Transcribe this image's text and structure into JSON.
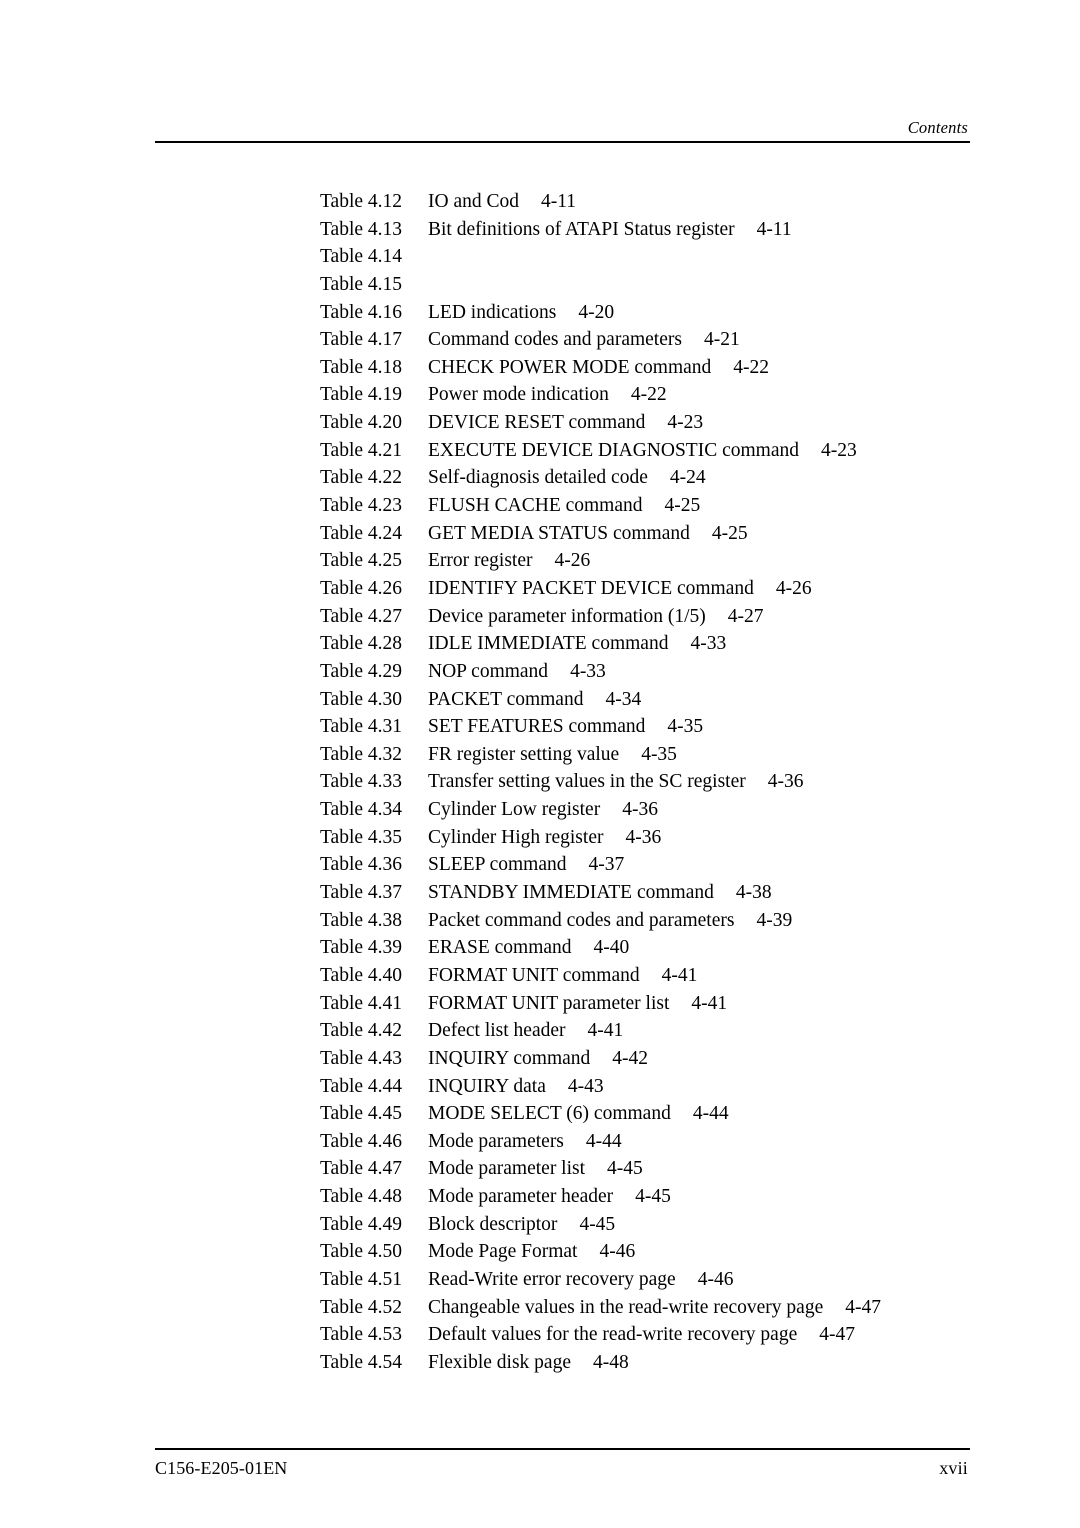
{
  "header": {
    "title": "Contents"
  },
  "footer": {
    "document_code": "C156-E205-01EN",
    "page_number": "xvii"
  },
  "toc": {
    "entries": [
      {
        "label": "Table 4.12",
        "title": "IO and Cod",
        "page": "4-11"
      },
      {
        "label": "Table 4.13",
        "title": "Bit definitions of ATAPI Status register",
        "page": "4-11"
      },
      {
        "label": "Table 4.14",
        "title": "",
        "page": ""
      },
      {
        "label": "Table 4.15",
        "title": "",
        "page": ""
      },
      {
        "label": "Table 4.16",
        "title": "LED indications",
        "page": "4-20"
      },
      {
        "label": "Table 4.17",
        "title": "Command codes and parameters",
        "page": "4-21"
      },
      {
        "label": "Table 4.18",
        "title": "CHECK POWER MODE command",
        "page": "4-22"
      },
      {
        "label": "Table 4.19",
        "title": "Power mode indication",
        "page": "4-22"
      },
      {
        "label": "Table 4.20",
        "title": "DEVICE RESET command",
        "page": "4-23"
      },
      {
        "label": "Table 4.21",
        "title": "EXECUTE DEVICE DIAGNOSTIC command",
        "page": "4-23"
      },
      {
        "label": "Table 4.22",
        "title": "Self-diagnosis detailed code",
        "page": "4-24"
      },
      {
        "label": "Table 4.23",
        "title": "FLUSH CACHE command",
        "page": "4-25"
      },
      {
        "label": "Table 4.24",
        "title": "GET MEDIA STATUS command",
        "page": "4-25"
      },
      {
        "label": "Table 4.25",
        "title": "Error register",
        "page": "4-26"
      },
      {
        "label": "Table 4.26",
        "title": "IDENTIFY PACKET DEVICE command",
        "page": "4-26"
      },
      {
        "label": "Table 4.27",
        "title": "Device parameter information (1/5)",
        "page": "4-27"
      },
      {
        "label": "Table 4.28",
        "title": "IDLE IMMEDIATE command",
        "page": "4-33"
      },
      {
        "label": "Table 4.29",
        "title": "NOP command",
        "page": "4-33"
      },
      {
        "label": "Table 4.30",
        "title": "PACKET command",
        "page": "4-34"
      },
      {
        "label": "Table 4.31",
        "title": "SET FEATURES command",
        "page": "4-35"
      },
      {
        "label": "Table 4.32",
        "title": "FR register setting value",
        "page": "4-35"
      },
      {
        "label": "Table 4.33",
        "title": "Transfer setting values in the SC register",
        "page": "4-36"
      },
      {
        "label": "Table 4.34",
        "title": "Cylinder Low register",
        "page": "4-36"
      },
      {
        "label": "Table 4.35",
        "title": "Cylinder High register",
        "page": "4-36"
      },
      {
        "label": "Table 4.36",
        "title": "SLEEP command",
        "page": "4-37"
      },
      {
        "label": "Table 4.37",
        "title": "STANDBY IMMEDIATE command",
        "page": "4-38"
      },
      {
        "label": "Table 4.38",
        "title": "Packet command codes and parameters",
        "page": "4-39"
      },
      {
        "label": "Table 4.39",
        "title": "ERASE command",
        "page": "4-40"
      },
      {
        "label": "Table 4.40",
        "title": "FORMAT UNIT command",
        "page": "4-41"
      },
      {
        "label": "Table 4.41",
        "title": "FORMAT UNIT parameter list",
        "page": "4-41"
      },
      {
        "label": "Table 4.42",
        "title": "Defect list header",
        "page": "4-41"
      },
      {
        "label": "Table 4.43",
        "title": "INQUIRY command",
        "page": "4-42"
      },
      {
        "label": "Table 4.44",
        "title": "INQUIRY data",
        "page": "4-43"
      },
      {
        "label": "Table 4.45",
        "title": "MODE SELECT (6) command",
        "page": "4-44"
      },
      {
        "label": "Table 4.46",
        "title": "Mode parameters",
        "page": "4-44"
      },
      {
        "label": "Table 4.47",
        "title": "Mode parameter list",
        "page": "4-45"
      },
      {
        "label": "Table 4.48",
        "title": "Mode parameter header",
        "page": "4-45"
      },
      {
        "label": "Table 4.49",
        "title": "Block descriptor",
        "page": "4-45"
      },
      {
        "label": "Table 4.50",
        "title": "Mode Page Format",
        "page": "4-46"
      },
      {
        "label": "Table 4.51",
        "title": "Read-Write error recovery page",
        "page": "4-46"
      },
      {
        "label": "Table 4.52",
        "title": "Changeable values in the read-write recovery page",
        "page": "4-47"
      },
      {
        "label": "Table 4.53",
        "title": "Default values for the read-write recovery page",
        "page": "4-47"
      },
      {
        "label": "Table 4.54",
        "title": "Flexible disk page",
        "page": "4-48"
      }
    ]
  }
}
